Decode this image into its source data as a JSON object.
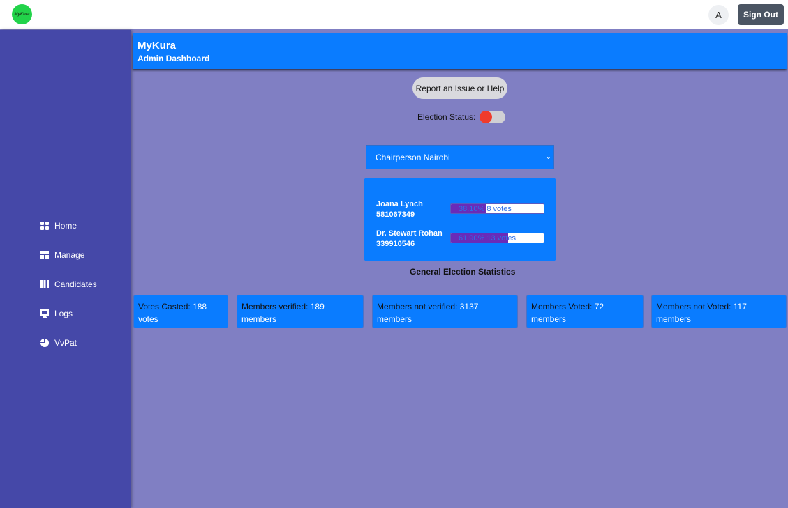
{
  "topbar": {
    "logo_text": "MyKura",
    "avatar_initial": "A",
    "signout_label": "Sign Out"
  },
  "sidebar": {
    "items": [
      {
        "label": "Home",
        "icon": "grid-icon"
      },
      {
        "label": "Manage",
        "icon": "layout-icon"
      },
      {
        "label": "Candidates",
        "icon": "columns-icon"
      },
      {
        "label": "Logs",
        "icon": "monitor-icon"
      },
      {
        "label": "VvPat",
        "icon": "pie-chart-icon"
      }
    ]
  },
  "header": {
    "title": "MyKura",
    "subtitle": "Admin Dashboard"
  },
  "report_button": "Report an Issue or Help",
  "election_status": {
    "label": "Election Status:",
    "active": false,
    "knob_color": "#ef3b2c"
  },
  "position_select": {
    "selected": "Chairperson Nairobi"
  },
  "candidates": [
    {
      "name": "Joana Lynch",
      "id": "581067349",
      "percent_label": "38.10%",
      "votes_label": "8 votes",
      "fraction": 0.381
    },
    {
      "name": "Dr. Stewart Rohan",
      "id": "339910546",
      "percent_label": "61.90%",
      "votes_label": "13 votes",
      "fraction": 0.619
    }
  ],
  "stats_title": "General Election Statistics",
  "stats": [
    {
      "label": "Votes Casted:",
      "value": "188",
      "unit": "votes"
    },
    {
      "label": "Members verified:",
      "value": "189",
      "unit": "members"
    },
    {
      "label": "Members not verified:",
      "value": "3137",
      "unit": "members"
    },
    {
      "label": "Members Voted:",
      "value": "72",
      "unit": "members"
    },
    {
      "label": "Members not Voted:",
      "value": "117",
      "unit": "members"
    }
  ],
  "colors": {
    "primary": "#0a7cff",
    "sidebar": "#4548a8",
    "background": "#807fc3",
    "bar_fill": "#6a2bb8"
  }
}
